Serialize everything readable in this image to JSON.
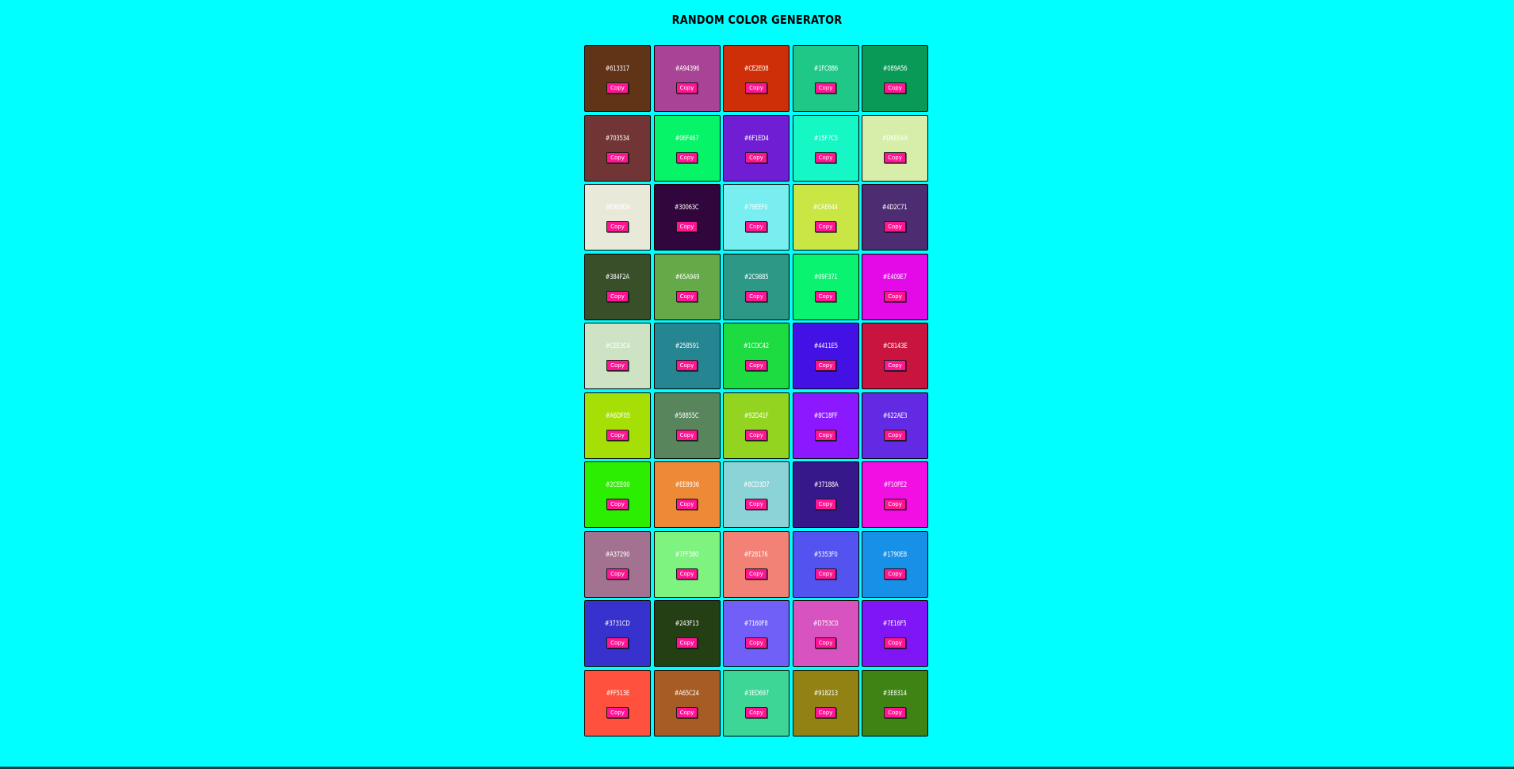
{
  "header": {
    "title": "RANDOM COLOR GENERATOR"
  },
  "copy_label": "Copy",
  "colors": [
    "#613317",
    "#A94396",
    "#CE2E08",
    "#1FC886",
    "#089A56",
    "#703534",
    "#06F467",
    "#6F1ED4",
    "#15F7C5",
    "#D6EEAA",
    "#E9E9DA",
    "#30063C",
    "#79EEF0",
    "#CAE644",
    "#4D2C71",
    "#384F2A",
    "#65A949",
    "#2C9885",
    "#09F371",
    "#E409E7",
    "#CEE3C4",
    "#258591",
    "#1CDC42",
    "#4411E5",
    "#C8143E",
    "#A6DF05",
    "#58855C",
    "#92D41F",
    "#8C18FF",
    "#622AE3",
    "#2CEE00",
    "#EE8936",
    "#8CD3D7",
    "#37188A",
    "#F10FE2",
    "#A37290",
    "#7FF380",
    "#F28176",
    "#5353F0",
    "#1790E8",
    "#3731CD",
    "#243F13",
    "#7160F8",
    "#D753C0",
    "#7E16F5",
    "#FF513E",
    "#A65C24",
    "#3ED697",
    "#918213",
    "#3E8314"
  ]
}
